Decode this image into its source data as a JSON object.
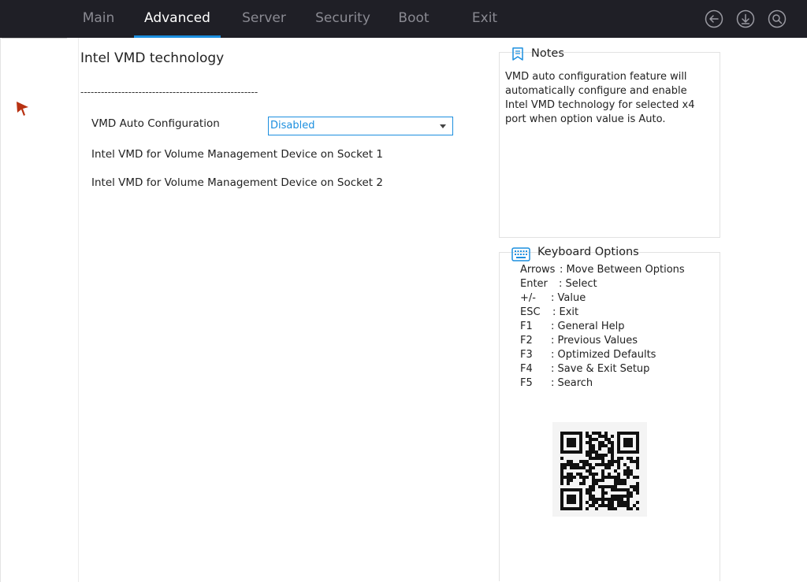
{
  "topbar": {
    "tabs": [
      {
        "label": "Main"
      },
      {
        "label": "Advanced"
      },
      {
        "label": "Server"
      },
      {
        "label": "Security"
      },
      {
        "label": "Boot"
      },
      {
        "label": "Exit"
      }
    ],
    "active_tab": "Advanced",
    "icons": [
      "back-icon",
      "download-icon",
      "search-icon"
    ],
    "accent": "#1c8fdf",
    "bg": "#1f1f26"
  },
  "main": {
    "title": "Intel VMD technology",
    "divider": "----------------------------------------------------",
    "settings": [
      {
        "label": "VMD Auto Configuration",
        "value": "Disabled"
      },
      {
        "label": "Intel VMD for Volume Management Device on Socket 1"
      },
      {
        "label": "Intel VMD for Volume Management Device on Socket 2"
      }
    ]
  },
  "notes": {
    "title": "Notes",
    "text": "VMD auto configuration feature will automatically configure and enable Intel VMD technology for selected x4 port when option value is Auto."
  },
  "keyboard": {
    "title": "Keyboard Options",
    "rows": [
      {
        "key": "Arrows",
        "desc": ": Move Between Options"
      },
      {
        "key": "Enter",
        "desc": ": Select"
      },
      {
        "key": "+/-",
        "desc": ": Value"
      },
      {
        "key": "ESC",
        "desc": ": Exit"
      },
      {
        "key": "F1",
        "desc": ": General Help"
      },
      {
        "key": "F2",
        "desc": ": Previous Values"
      },
      {
        "key": "F3",
        "desc": ": Optimized Defaults"
      },
      {
        "key": "F4",
        "desc": ": Save & Exit Setup"
      },
      {
        "key": "F5",
        "desc": ": Search"
      }
    ]
  }
}
